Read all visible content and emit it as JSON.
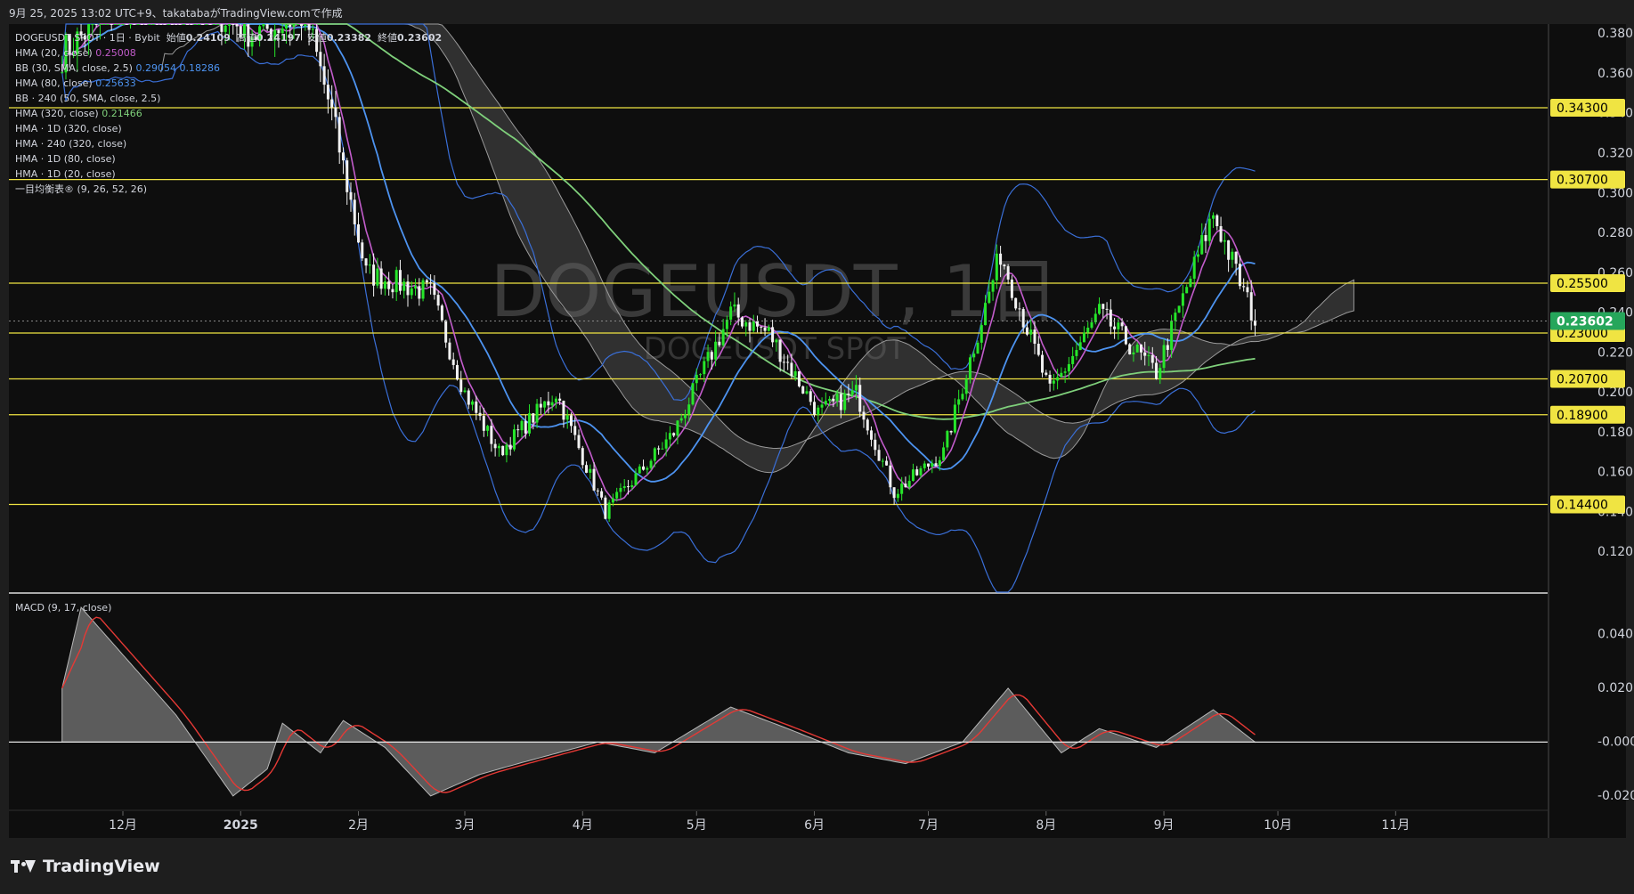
{
  "header": {
    "timestamp_line": "9月 25, 2025 13:02 UTC+9、takatabaがTradingView.comで作成"
  },
  "legend": {
    "symbol_line": "DOGEUSDT SPOT · 1日 · Bybit",
    "open_label": "始値",
    "open_value": "0.24109",
    "high_label": "高値",
    "high_value": "0.24197",
    "low_label": "安値",
    "low_value": "0.23382",
    "close_label": "終値",
    "close_value": "0.23602",
    "indicators": [
      {
        "name": "HMA (20, close)",
        "value": "0.25008",
        "value2": ""
      },
      {
        "name": "BB (30, SMA, close, 2.5)",
        "value": "0.29054",
        "value2": "0.18286"
      },
      {
        "name": "HMA (80, close)",
        "value": "0.25633",
        "value2": ""
      },
      {
        "name": "BB · 240 (50, SMA, close, 2.5)",
        "value": "",
        "value2": ""
      },
      {
        "name": "HMA (320, close)",
        "value": "0.21466",
        "value2": ""
      },
      {
        "name": "HMA · 1D (320, close)",
        "value": "",
        "value2": ""
      },
      {
        "name": "HMA · 240 (320, close)",
        "value": "",
        "value2": ""
      },
      {
        "name": "HMA · 1D (80, close)",
        "value": "",
        "value2": ""
      },
      {
        "name": "HMA · 1D (20, close)",
        "value": "",
        "value2": ""
      },
      {
        "name": "一目均衡表® (9, 26, 52, 26)",
        "value": "",
        "value2": ""
      }
    ]
  },
  "watermark": {
    "main": "DOGEUSDT, 1日",
    "sub": "DOGEUSDT SPOT"
  },
  "macd_label": "MACD (9, 17, close)",
  "brand": "TradingView",
  "colors": {
    "background": "#0e0e0e",
    "up": "#26e62a",
    "down": "#f2f2f2",
    "level_line": "#f0e442",
    "hma20": "#c25ccb",
    "hma80": "#4d93f0",
    "hma320": "#7fd07b",
    "bb": "#3a6fd8",
    "cloud": "#6f6f6f",
    "macd_signal": "#e53935",
    "last_price_bg": "#26a65b"
  },
  "chart_data": [
    {
      "type": "candlestick",
      "title": "DOGEUSDT SPOT · 1日 · Bybit",
      "ylim": [
        0.1,
        0.385
      ],
      "y_ticks": [
        "0.38000",
        "0.36000",
        "0.34000",
        "0.32000",
        "0.30000",
        "0.28000",
        "0.26000",
        "0.24000",
        "0.22000",
        "0.20000",
        "0.18000",
        "0.16000",
        "0.14000",
        "0.12000"
      ],
      "x_ticks": [
        "12月",
        "2025",
        "2月",
        "3月",
        "4月",
        "5月",
        "6月",
        "7月",
        "8月",
        "9月",
        "10月",
        "11月"
      ],
      "horizontal_levels": [
        "0.34300",
        "0.30700",
        "0.25500",
        "0.23000",
        "0.20700",
        "0.18900",
        "0.14400"
      ],
      "last_price": "0.23602",
      "series_close_keypoints": [
        [
          "2024-11-15",
          0.37
        ],
        [
          "2024-12-08",
          0.41
        ],
        [
          "2025-01-05",
          0.38
        ],
        [
          "2025-01-18",
          0.39
        ],
        [
          "2025-01-25",
          0.34
        ],
        [
          "2025-02-03",
          0.26
        ],
        [
          "2025-02-20",
          0.25
        ],
        [
          "2025-03-01",
          0.2
        ],
        [
          "2025-03-10",
          0.17
        ],
        [
          "2025-03-25",
          0.2
        ],
        [
          "2025-04-07",
          0.14
        ],
        [
          "2025-04-25",
          0.18
        ],
        [
          "2025-05-10",
          0.24
        ],
        [
          "2025-05-20",
          0.23
        ],
        [
          "2025-06-02",
          0.19
        ],
        [
          "2025-06-12",
          0.2
        ],
        [
          "2025-06-22",
          0.15
        ],
        [
          "2025-07-05",
          0.17
        ],
        [
          "2025-07-20",
          0.27
        ],
        [
          "2025-08-02",
          0.2
        ],
        [
          "2025-08-15",
          0.24
        ],
        [
          "2025-08-30",
          0.21
        ],
        [
          "2025-09-14",
          0.29
        ],
        [
          "2025-09-25",
          0.236
        ]
      ]
    },
    {
      "type": "area",
      "title": "MACD (9, 17, close)",
      "ylim": [
        -0.025,
        0.055
      ],
      "y_ticks": [
        "0.04000",
        "0.02000",
        "-0.00000",
        "-0.02000"
      ],
      "macd_keypoints": [
        [
          "2024-11-15",
          0.02
        ],
        [
          "2024-11-20",
          0.05
        ],
        [
          "2024-12-15",
          0.01
        ],
        [
          "2024-12-30",
          -0.02
        ],
        [
          "2025-01-08",
          -0.01
        ],
        [
          "2025-01-12",
          0.007
        ],
        [
          "2025-01-22",
          -0.004
        ],
        [
          "2025-01-28",
          0.008
        ],
        [
          "2025-02-08",
          -0.002
        ],
        [
          "2025-02-20",
          -0.02
        ],
        [
          "2025-03-05",
          -0.012
        ],
        [
          "2025-03-15",
          -0.008
        ],
        [
          "2025-04-05",
          0.0
        ],
        [
          "2025-04-20",
          -0.004
        ],
        [
          "2025-05-10",
          0.013
        ],
        [
          "2025-05-25",
          0.005
        ],
        [
          "2025-06-10",
          -0.004
        ],
        [
          "2025-06-25",
          -0.008
        ],
        [
          "2025-07-10",
          0.0
        ],
        [
          "2025-07-22",
          0.02
        ],
        [
          "2025-08-05",
          -0.004
        ],
        [
          "2025-08-15",
          0.005
        ],
        [
          "2025-08-30",
          -0.002
        ],
        [
          "2025-09-14",
          0.012
        ],
        [
          "2025-09-25",
          0.0
        ]
      ],
      "zero_level": "-0.00000"
    }
  ]
}
